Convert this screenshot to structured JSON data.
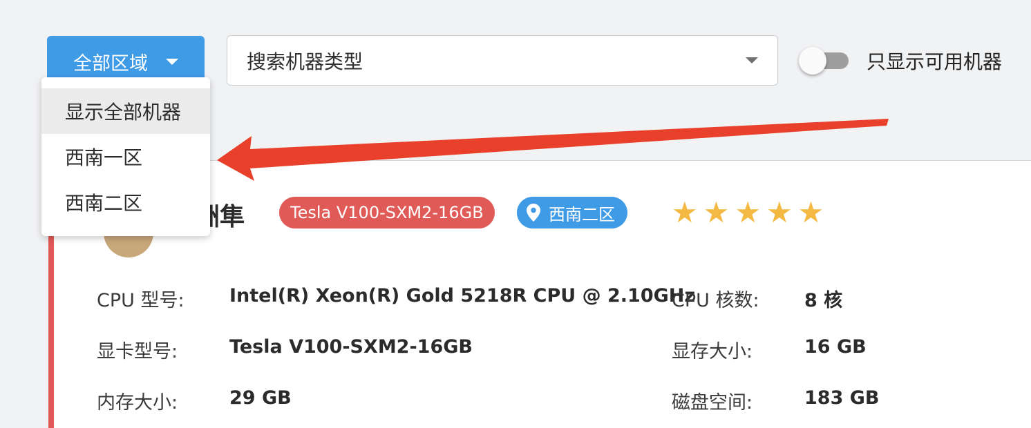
{
  "toolbar": {
    "region_button_label": "全部区域",
    "search_placeholder": "搜索机器类型",
    "toggle_label": "只显示可用机器",
    "toggle_on": false
  },
  "dropdown": {
    "items": [
      {
        "label": "显示全部机器",
        "selected": true
      },
      {
        "label": "西南一区",
        "selected": false
      },
      {
        "label": "西南二区",
        "selected": false
      }
    ]
  },
  "machine": {
    "name_visible": "洲隼",
    "gpu_tag": "Tesla V100-SXM2-16GB",
    "region_tag": "西南二区",
    "rating_stars": 5,
    "specs": {
      "cpu_model_label": "CPU 型号:",
      "cpu_model_value": "Intel(R) Xeon(R) Gold 5218R CPU @ 2.10GHz",
      "cpu_cores_label": "CPU 核数:",
      "cpu_cores_value": "8 核",
      "gpu_model_label": "显卡型号:",
      "gpu_model_value": "Tesla V100-SXM2-16GB",
      "vram_label": "显存大小:",
      "vram_value": "16 GB",
      "ram_label": "内存大小:",
      "ram_value": "29 GB",
      "disk_label": "磁盘空间:",
      "disk_value": "183 GB"
    }
  },
  "colors": {
    "primary": "#3f9be6",
    "danger": "#e05a57",
    "star": "#f4b942",
    "annotation_arrow": "#e8402a"
  }
}
